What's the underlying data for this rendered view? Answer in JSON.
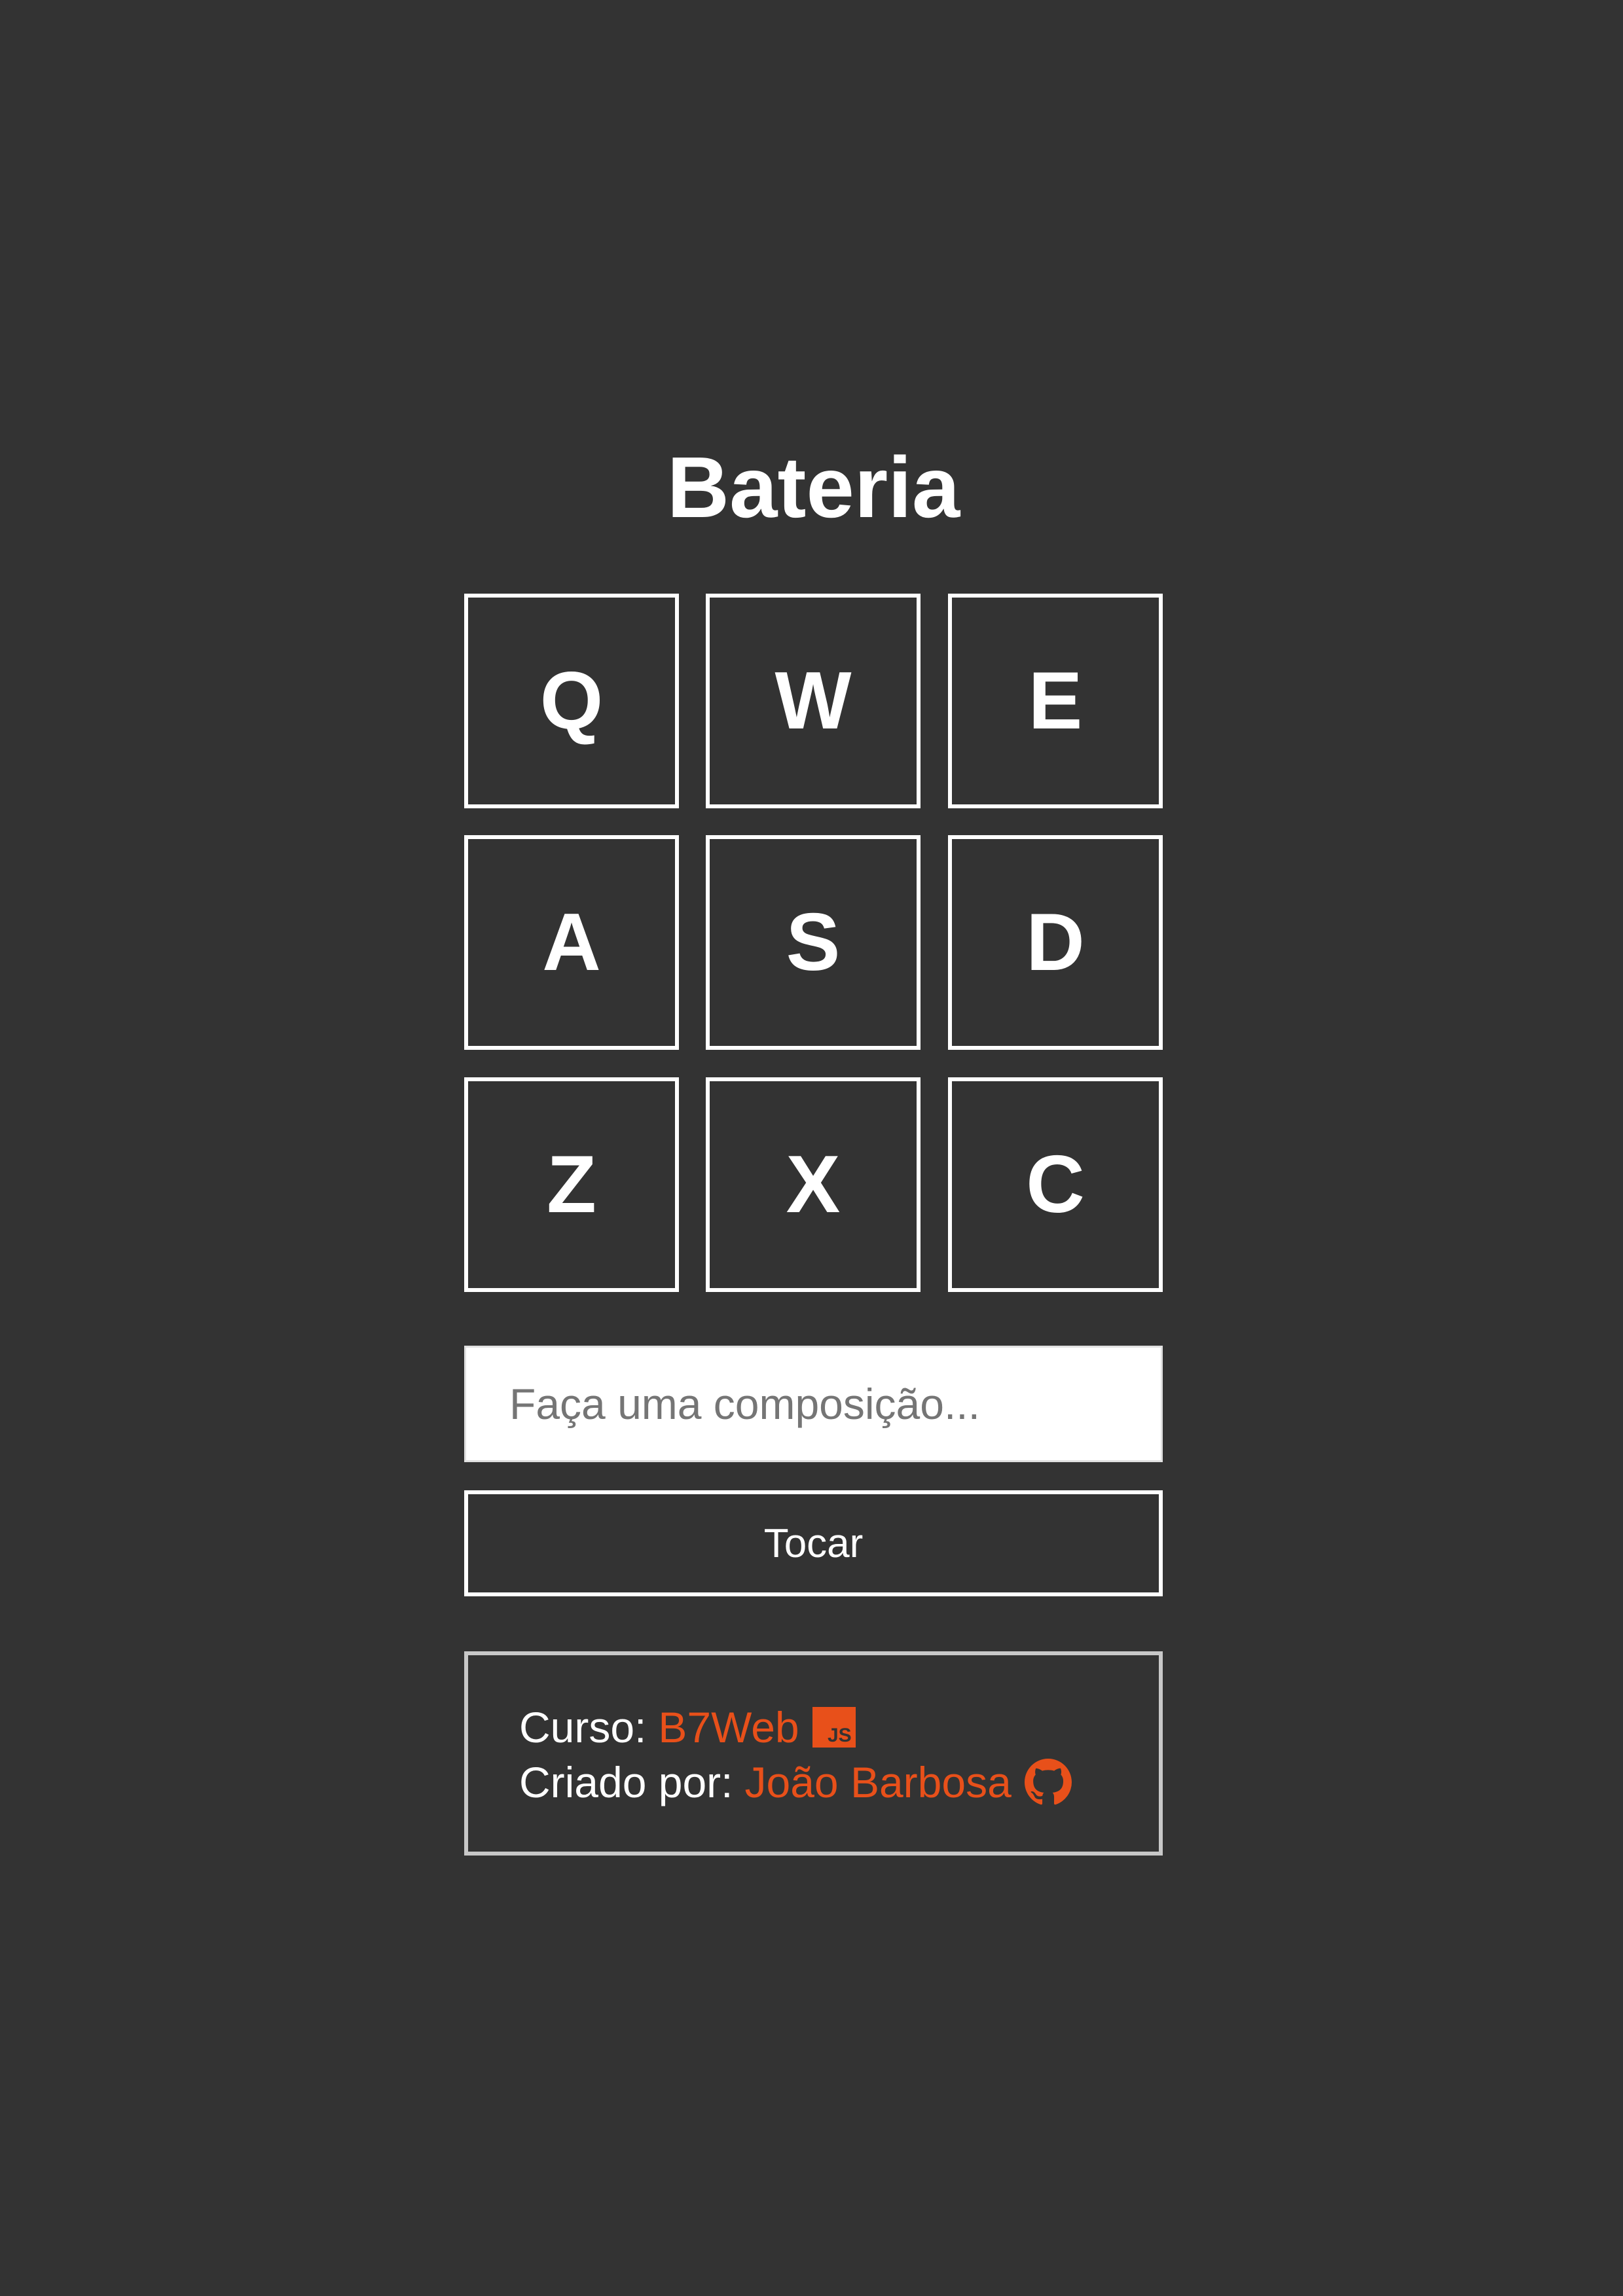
{
  "page": {
    "title": "Bateria"
  },
  "keys": [
    {
      "label": "Q"
    },
    {
      "label": "W"
    },
    {
      "label": "E"
    },
    {
      "label": "A"
    },
    {
      "label": "S"
    },
    {
      "label": "D"
    },
    {
      "label": "Z"
    },
    {
      "label": "X"
    },
    {
      "label": "C"
    }
  ],
  "composition": {
    "value": "",
    "placeholder": "Faça uma composição..."
  },
  "play_button": {
    "label": "Tocar"
  },
  "credits": {
    "course_label": "Curso:",
    "course_name": "B7Web",
    "course_badge": "JS",
    "author_label": "Criado por:",
    "author_name": "João Barbosa",
    "author_icon": "github-icon"
  },
  "colors": {
    "background": "#333333",
    "accent": "#e8501a",
    "text": "#ffffff"
  }
}
